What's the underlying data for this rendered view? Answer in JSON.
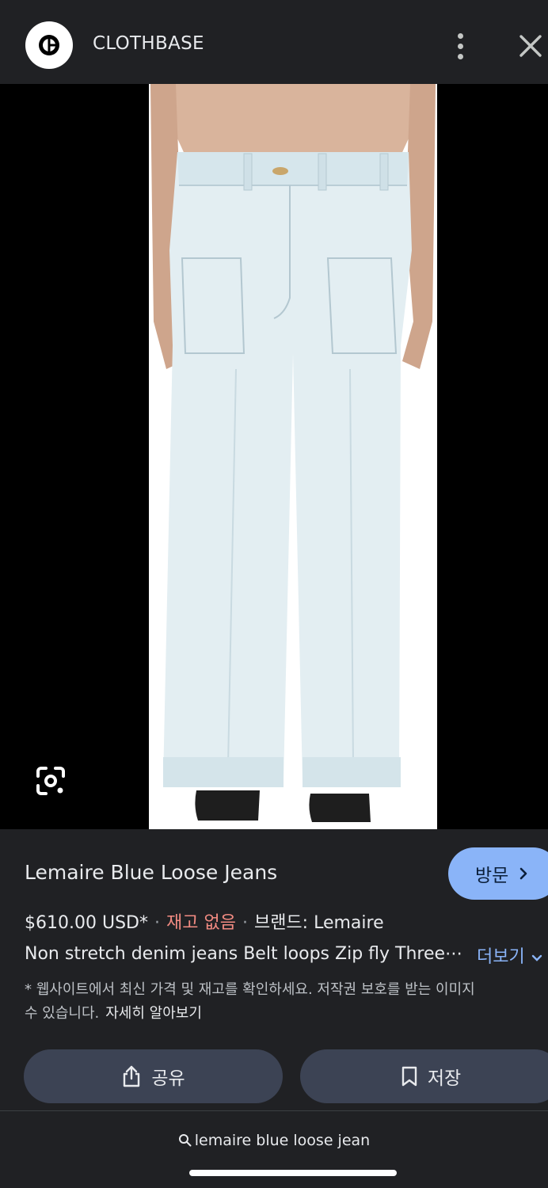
{
  "header": {
    "site_name": "CLOTHBASE",
    "logo_icon": "clothbase-logo-icon",
    "more_icon": "more-vert-icon",
    "close_icon": "close-icon"
  },
  "image": {
    "lens_icon": "google-lens-icon",
    "background": "#000000"
  },
  "product": {
    "title": "Lemaire Blue Loose Jeans",
    "price": "$610.00 USD*",
    "separator": "·",
    "stock": "재고 없음",
    "brand": "브랜드: Lemaire",
    "description": "Non stretch denim jeans Belt loops Zip fly Three⋯",
    "more_label": "더보기",
    "note_line1": "* 웹사이트에서 최신 가격 및 재고를 확인하세요. 저작권 보호를 받는 이미지",
    "note_line2": "수 있습니다.",
    "learn_more": "자세히 알아보기"
  },
  "actions": {
    "visit_label": "방문",
    "share_label": "공유",
    "save_label": "저장"
  },
  "search": {
    "query": "lemaire blue loose jean"
  },
  "colors": {
    "background": "#202124",
    "accent": "#8ab4f8",
    "out_of_stock": "#f28b82",
    "button": "#3c4354"
  }
}
